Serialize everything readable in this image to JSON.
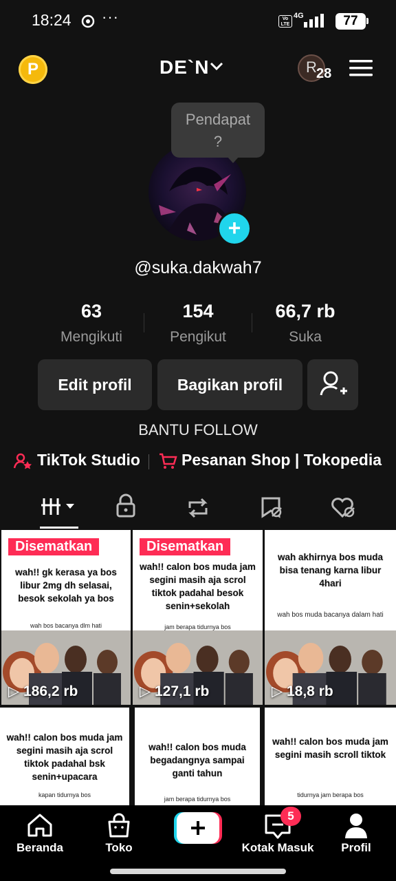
{
  "status_bar": {
    "time": "18:24",
    "overflow": "···",
    "volte": "Vo LTE",
    "network": "4G",
    "battery": "77"
  },
  "header": {
    "coin_label": "P",
    "account_name": "DE`N",
    "avatar_initial": "R",
    "notification_count": "28"
  },
  "tooltip": {
    "line1": "Pendapat",
    "line2": "?"
  },
  "profile": {
    "username": "@suka.dakwah7",
    "stats": [
      {
        "value": "63",
        "label": "Mengikuti"
      },
      {
        "value": "154",
        "label": "Pengikut"
      },
      {
        "value": "66,7 rb",
        "label": "Suka"
      }
    ],
    "buttons": {
      "edit": "Edit profil",
      "share": "Bagikan profil"
    },
    "bio": "BANTU FOLLOW",
    "links": {
      "studio": "TikTok Studio",
      "shop": "Pesanan Shop | Tokopedia"
    }
  },
  "tabs": [
    "videos-grid",
    "private",
    "reposts",
    "favorites",
    "liked"
  ],
  "videos": [
    {
      "pinned": "Disematkan",
      "caption": "wah!! gk kerasa ya bos libur 2mg dh selasai, besok sekolah ya bos",
      "sub": "wah bos bacanya dlm hati",
      "views": "186,2 rb"
    },
    {
      "pinned": "Disematkan",
      "caption": "wah!! calon bos muda jam segini masih aja scrol tiktok padahal besok senin+sekolah",
      "sub": "jam berapa tidurnya bos",
      "views": "127,1 rb"
    },
    {
      "pinned": "",
      "caption": "wah akhirnya bos muda bisa tenang karna libur 4hari",
      "sub": "wah bos muda bacanya dalam hati",
      "views": "18,8 rb"
    },
    {
      "pinned": "",
      "caption": "wah!! calon bos muda jam segini masih aja scrol tiktok padahal bsk senin+upacara",
      "sub": "kapan tidurnya bos",
      "views": ""
    },
    {
      "pinned": "",
      "caption": "wah!! calon bos muda begadangnya sampai ganti tahun",
      "sub": "jam berapa tidurnya bos",
      "views": ""
    },
    {
      "pinned": "",
      "caption": "wah!! calon bos muda jam segini masih scroll tiktok",
      "sub": "tidurnya jam berapa bos",
      "views": ""
    }
  ],
  "nav": {
    "home": "Beranda",
    "shop": "Toko",
    "inbox": "Kotak Masuk",
    "inbox_badge": "5",
    "profile": "Profil"
  },
  "colors": {
    "accent_red": "#fe2c55",
    "accent_cyan": "#20d5ec",
    "coin": "#f5b90c"
  }
}
